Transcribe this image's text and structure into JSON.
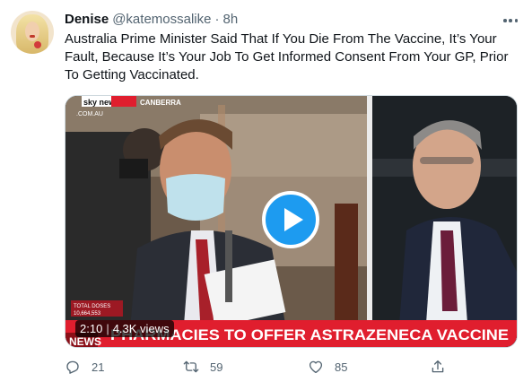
{
  "tweet": {
    "display_name": "Denise",
    "handle": "@katemossalike",
    "separator": "·",
    "time": "8h",
    "text": "Australia Prime Minister Said That If You Die From The Vaccine, It’s Your Fault, Because It’s Your Job To Get Informed Consent From Your GP, Prior To Getting Vaccinated."
  },
  "video": {
    "channel_logo": "sky news",
    "channel_domain": ".COM.AU",
    "location": "CANBERRA",
    "total_doses_label": "TOTAL DOSES",
    "total_doses_value": "10,664,553",
    "headline_prefix": "NEWS",
    "headline": "PHARMACIES TO OFFER ASTRAZENECA VACCINE",
    "duration": "2:10",
    "views": "4.3K views",
    "play_icon": "play-icon"
  },
  "actions": {
    "reply_count": "21",
    "retweet_count": "59",
    "like_count": "85",
    "icons": [
      "reply-icon",
      "retweet-icon",
      "heart-icon",
      "share-icon"
    ]
  },
  "colors": {
    "accent": "#1d9bf0",
    "secondary_text": "#536471",
    "sky_red": "#e01e2e"
  }
}
